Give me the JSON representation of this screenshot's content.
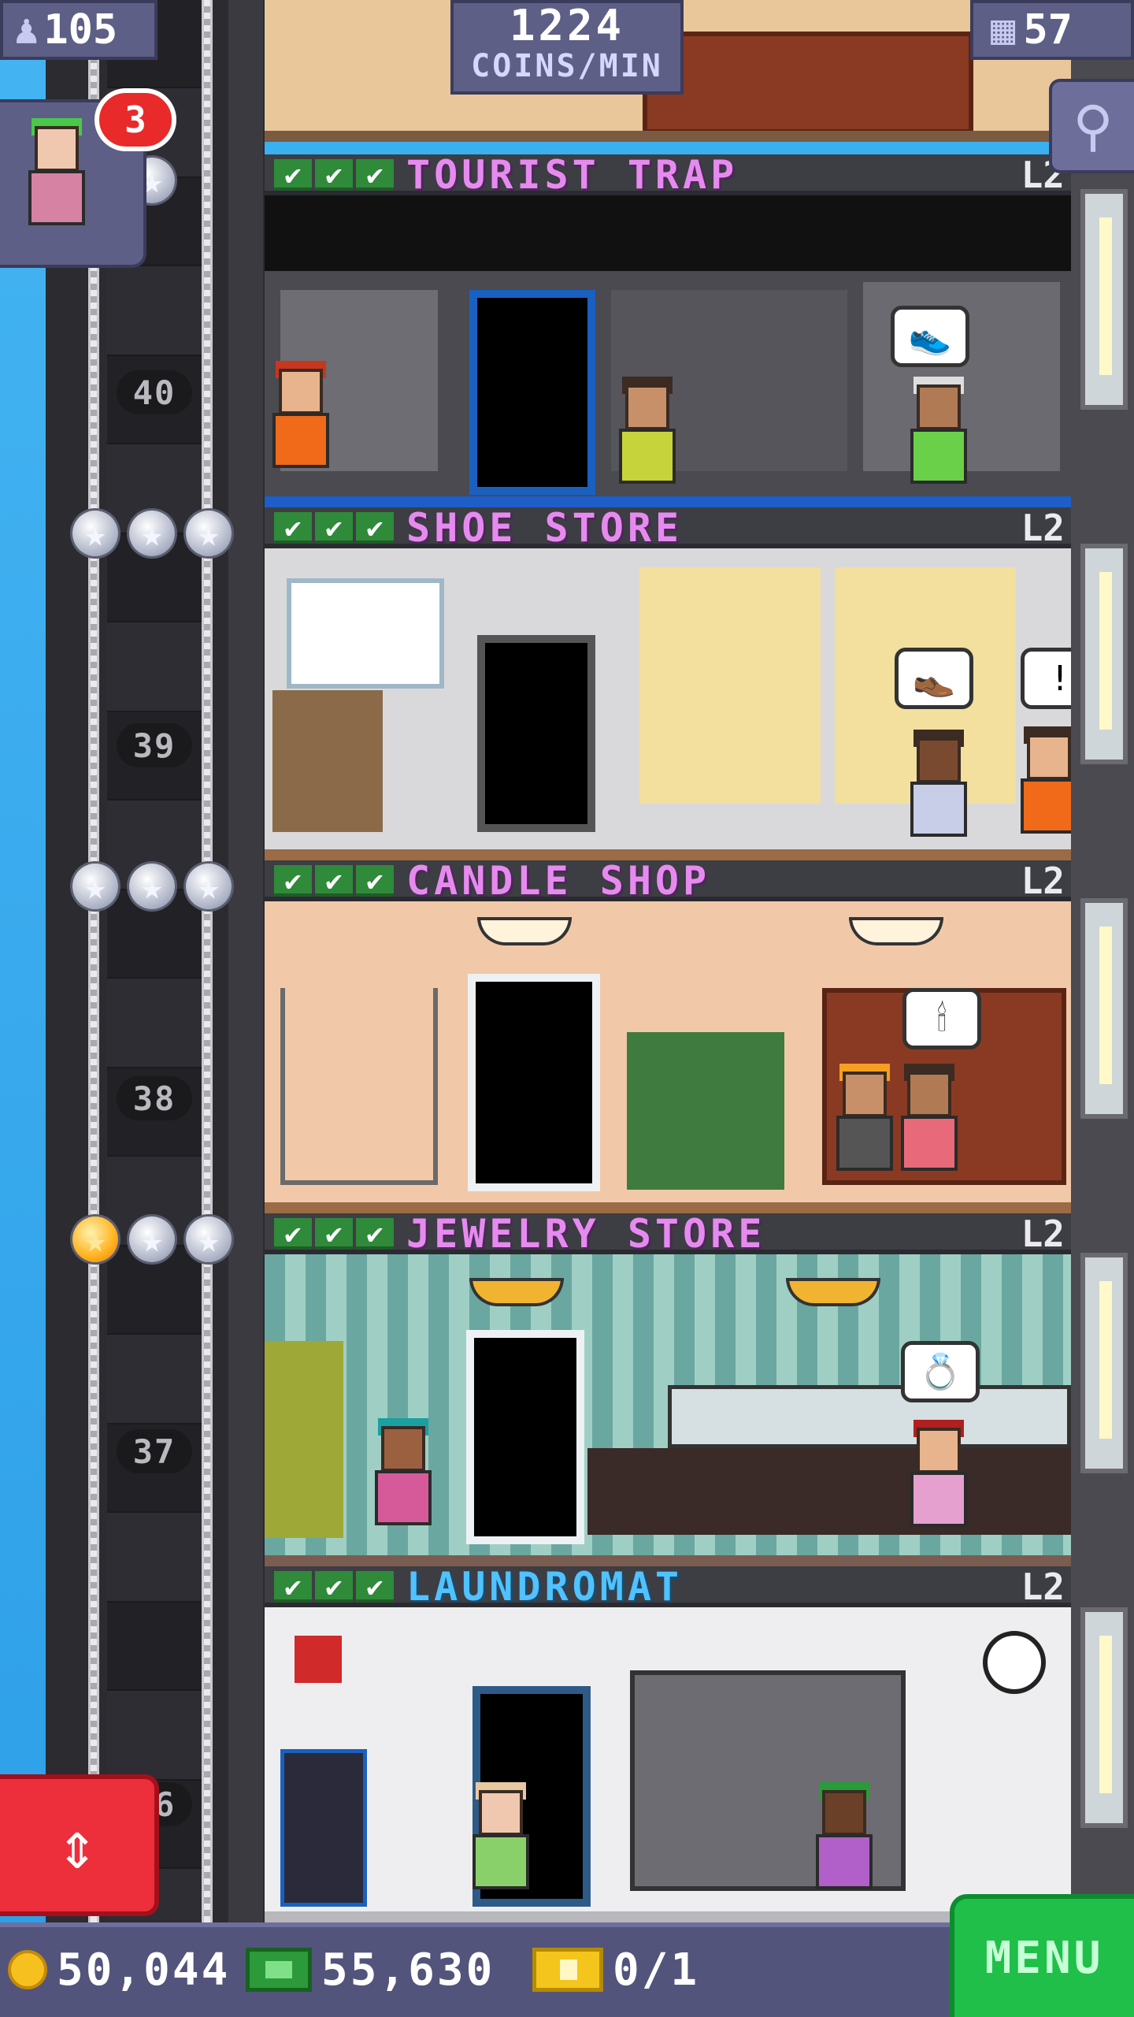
{
  "hud": {
    "population": "105",
    "coins_per_min_value": "1224",
    "coins_per_min_unit": "COINS/MIN",
    "floors": "57",
    "visitor_count": "3"
  },
  "elevator": {
    "floor_numbers": [
      "40",
      "39",
      "38",
      "37",
      "36"
    ]
  },
  "floors": [
    {
      "name": "TOURIST TRAP",
      "level": "L2"
    },
    {
      "name": "SHOE STORE",
      "level": "L2"
    },
    {
      "name": "CANDLE SHOP",
      "level": "L2"
    },
    {
      "name": "JEWELRY STORE",
      "level": "L2"
    },
    {
      "name": "LAUNDROMAT",
      "level": "L2"
    }
  ],
  "bottom_bar": {
    "coins": "50,044",
    "bux": "55,630",
    "tickets": "0/1",
    "menu_label": "MENU"
  },
  "icons": {
    "check": "✔",
    "star": "★",
    "search": "⚲",
    "elevator_updown": "⇕",
    "person": "♟",
    "building": "▦",
    "bubble_exclaim": "!"
  },
  "colors": {
    "floor_name_pink": "#e78af0",
    "floor_name_blue": "#4fc2ff",
    "check_green": "#2f8a3a",
    "hud_purple": "#5e5f86",
    "menu_green": "#1fbf4a",
    "elevator_red": "#ec2f3b"
  }
}
